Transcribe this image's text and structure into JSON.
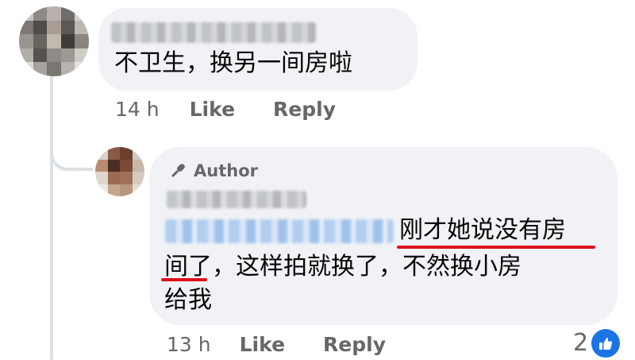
{
  "comment_1": {
    "text": "不卫生，换另一间房啦",
    "time": "14 h",
    "like_label": "Like",
    "reply_label": "Reply"
  },
  "comment_2": {
    "author_badge": "Author",
    "text_line_1": "刚才她说没有房",
    "text_line_2": "间了，这样拍就换了，不然换小房",
    "text_line_3": "给我",
    "time": "13 h",
    "like_label": "Like",
    "reply_label": "Reply",
    "reaction_count": "2",
    "reaction_icon": "thumbs-up-icon"
  },
  "colors": {
    "bubble": "#f0f2f5",
    "meta_text": "#65676b",
    "underline": "#e0101a",
    "like_blue": "#1b74e4",
    "thread_line": "#dcdfe3"
  }
}
